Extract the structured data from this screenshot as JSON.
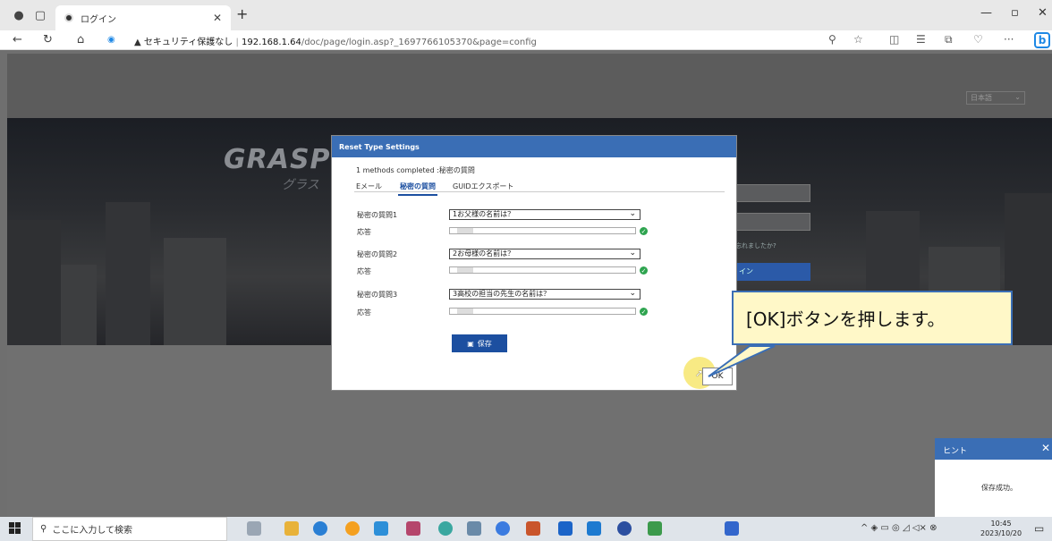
{
  "browser": {
    "tab_title": "ログイン",
    "url_warning": "セキュリティ保護なし",
    "url_host": "192.168.1.64",
    "url_path": "/doc/page/login.asp?_1697766105370&page=config"
  },
  "page": {
    "language_select": "日本語",
    "brand": "GRASP",
    "brand_sub": "グラス",
    "forgot_link": "忘れましたか?",
    "login_button": "イン"
  },
  "dialog": {
    "title": "Reset Type Settings",
    "status": "1 methods completed :秘密の質問",
    "tabs": [
      {
        "label": "Eメール",
        "active": false
      },
      {
        "label": "秘密の質問",
        "active": true
      },
      {
        "label": "GUIDエクスポート",
        "active": false
      }
    ],
    "questions": [
      {
        "label": "秘密の質問1",
        "selected": "1お父様の名前は？",
        "answer_label": "応答"
      },
      {
        "label": "秘密の質問2",
        "selected": "2お母様の名前は？",
        "answer_label": "応答"
      },
      {
        "label": "秘密の質問3",
        "selected": "3高校の担当の先生の名前は？",
        "answer_label": "応答"
      }
    ],
    "save_label": "保存",
    "ok_label": "OK"
  },
  "callout": {
    "text": "[OK]ボタンを押します。"
  },
  "hint": {
    "title": "ヒント",
    "message": "保存成功。"
  },
  "taskbar": {
    "search_placeholder": "ここに入力して検索",
    "time": "10:45",
    "date": "2023/10/20"
  },
  "colors": {
    "accent": "#3a6eb5",
    "check": "#2ea44f",
    "callout_bg": "#fff8c8"
  }
}
